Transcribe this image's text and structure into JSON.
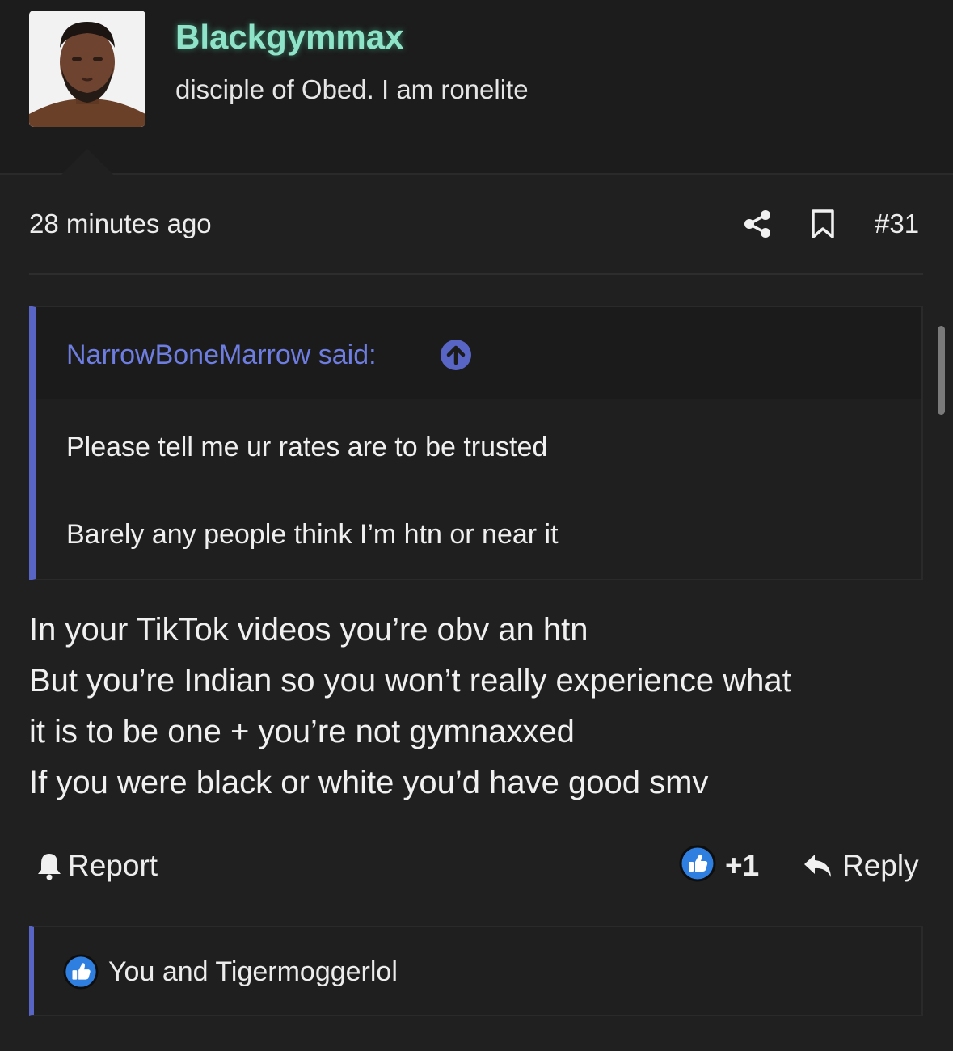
{
  "user": {
    "name": "Blackgymmax",
    "title": "disciple of Obed. I am ronelite"
  },
  "post": {
    "time": "28 minutes ago",
    "number": "#31"
  },
  "quote": {
    "author": "NarrowBoneMarrow said:",
    "lines": [
      "Please tell me ur rates are to be trusted",
      "Barely any people think I’m htn or near it"
    ]
  },
  "body": {
    "lines": [
      "In your TikTok videos you’re obv an htn",
      "But you’re Indian so you won’t really experience what",
      "it is to be one + you’re not gymnaxxed",
      "If you were black or white you’d have good smv"
    ]
  },
  "actions": {
    "report_label": "Report",
    "like_count": "+1",
    "reply_label": "Reply"
  },
  "reactions": {
    "text": "You and Tigermoggerlol"
  },
  "colors": {
    "background": "#202020",
    "username": "#8fe3c8",
    "quote_accent": "#5865c4",
    "like_blue": "#2f7fe0"
  },
  "icons": {
    "share": "share-icon",
    "bookmark": "bookmark-icon",
    "quote_jump": "arrow-up-circle-icon",
    "report": "bell-icon",
    "like": "thumbs-up-icon",
    "reply": "reply-arrow-icon"
  }
}
